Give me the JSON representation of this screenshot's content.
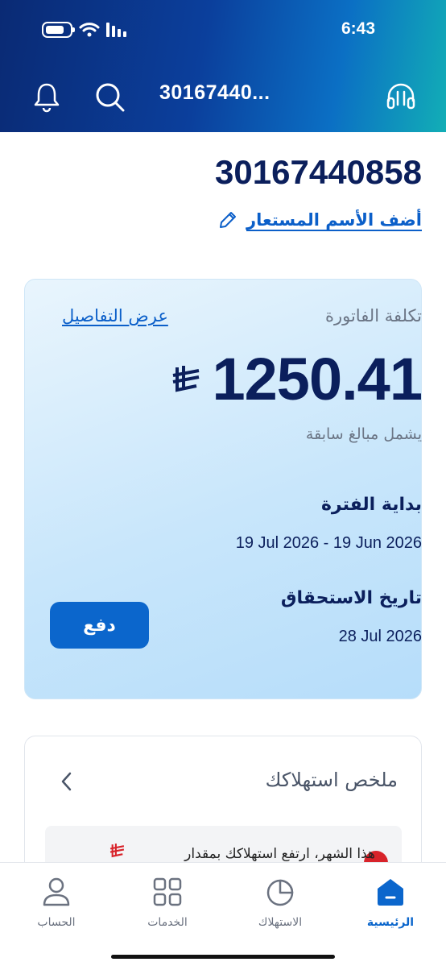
{
  "status_bar": {
    "time": "6:43"
  },
  "header": {
    "account_title": "30167440..."
  },
  "account": {
    "number": "30167440858",
    "add_nickname_label": "أضف الأسم المستعار"
  },
  "bill": {
    "cost_label": "تكلفة الفاتورة",
    "details_link": "عرض التفاصيل",
    "amount": "1250.41",
    "includes_previous": "يشمل مبالغ سابقة",
    "period_label": "بداية الفترة",
    "period_value": "19 Jul 2026 - 19 Jun 2026",
    "due_label": "تاريخ الاستحقاق",
    "due_value": "28 Jul 2026",
    "pay_button": "دفع"
  },
  "summary": {
    "title": "ملخص استهلاكك",
    "alert_text": "هذا الشهر، ارتفع استهلاكك بمقدار"
  },
  "tabbar": {
    "items": [
      {
        "label": "الرئيسية",
        "icon": "home-icon",
        "active": true
      },
      {
        "label": "الاستهلاك",
        "icon": "pie-chart-icon",
        "active": false
      },
      {
        "label": "الخدمات",
        "icon": "grid-icon",
        "active": false
      },
      {
        "label": "الحساب",
        "icon": "user-icon",
        "active": false
      }
    ]
  },
  "colors": {
    "primary": "#0b66cc",
    "navy": "#0b1f5c",
    "header_gradient_start": "#0a2a74",
    "header_gradient_end": "#12aeb6",
    "alert": "#d8232a"
  }
}
